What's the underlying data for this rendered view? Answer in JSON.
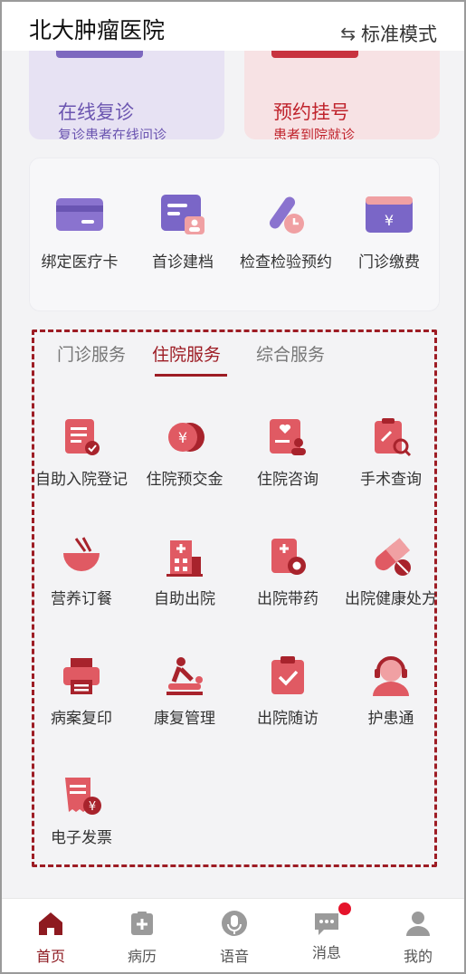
{
  "header": {
    "title": "北大肿瘤医院",
    "mode_switch": "标准模式",
    "mode_icon": "swap-icon"
  },
  "top_cards": [
    {
      "title": "在线复诊",
      "subtitle": "复诊患者在线问诊",
      "color": "#6b55b0"
    },
    {
      "title": "预约挂号",
      "subtitle": "患者到院就诊",
      "color": "#c0242d"
    }
  ],
  "quick_actions": [
    {
      "label": "绑定医疗卡",
      "icon": "medical-card-icon"
    },
    {
      "label": "首诊建档",
      "icon": "profile-card-icon"
    },
    {
      "label": "检查检验预约",
      "icon": "test-tube-clock-icon"
    },
    {
      "label": "门诊缴费",
      "icon": "yuan-card-icon"
    }
  ],
  "service_tabs": [
    {
      "label": "门诊服务",
      "active": false
    },
    {
      "label": "住院服务",
      "active": true
    },
    {
      "label": "综合服务",
      "active": false
    }
  ],
  "inpatient_services": [
    {
      "label": "自助入院登记",
      "icon": "admission-form-icon"
    },
    {
      "label": "住院预交金",
      "icon": "yuan-coin-icon"
    },
    {
      "label": "住院咨询",
      "icon": "consultation-icon"
    },
    {
      "label": "手术查询",
      "icon": "surgery-search-icon"
    },
    {
      "label": "营养订餐",
      "icon": "meal-bowl-icon"
    },
    {
      "label": "自助出院",
      "icon": "hospital-building-icon"
    },
    {
      "label": "出院带药",
      "icon": "discharge-medicine-icon"
    },
    {
      "label": "出院健康处方",
      "icon": "capsule-icon"
    },
    {
      "label": "病案复印",
      "icon": "printer-icon"
    },
    {
      "label": "康复管理",
      "icon": "massage-icon"
    },
    {
      "label": "出院随访",
      "icon": "clipboard-check-icon"
    },
    {
      "label": "护患通",
      "icon": "nurse-headset-icon"
    },
    {
      "label": "电子发票",
      "icon": "e-invoice-icon"
    }
  ],
  "bottom_nav": [
    {
      "label": "首页",
      "icon": "home-icon",
      "active": true
    },
    {
      "label": "病历",
      "icon": "medical-record-icon",
      "active": false
    },
    {
      "label": "语音",
      "icon": "microphone-icon",
      "active": false
    },
    {
      "label": "消息",
      "icon": "message-icon",
      "active": false,
      "badge": true
    },
    {
      "label": "我的",
      "icon": "user-icon",
      "active": false
    }
  ],
  "colors": {
    "accent": "#9d1c24",
    "icon_red": "#d9444e",
    "icon_purple": "#7d68bf",
    "badge": "#e5142b"
  }
}
